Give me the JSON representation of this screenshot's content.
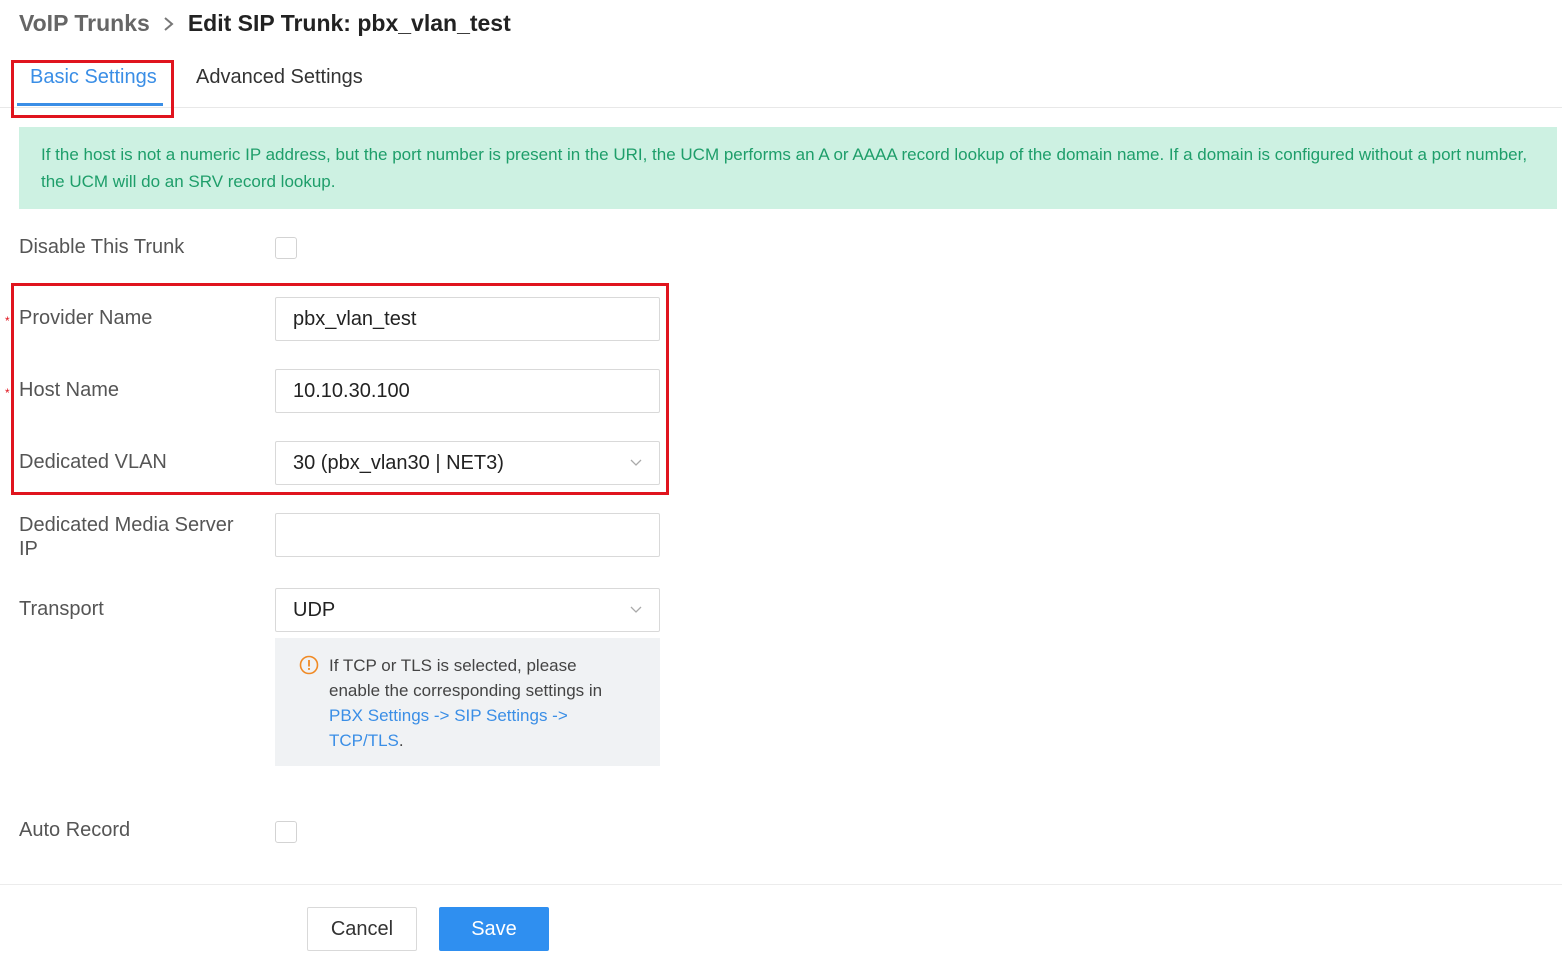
{
  "breadcrumb": {
    "parent": "VoIP Trunks",
    "separator_icon": "chevron-right-icon",
    "current": "Edit SIP Trunk: pbx_vlan_test"
  },
  "tabs": [
    {
      "label": "Basic Settings",
      "active": true
    },
    {
      "label": "Advanced Settings",
      "active": false
    }
  ],
  "notice": {
    "text": "If the host is not a numeric IP address, but the port number is present in the URI, the UCM performs an A or AAAA record lookup of the domain name. If a domain is configured without a port number, the UCM will do an SRV record lookup."
  },
  "form": {
    "disable_trunk": {
      "label": "Disable This Trunk",
      "checked": false
    },
    "provider_name": {
      "label": "Provider Name",
      "value": "pbx_vlan_test",
      "required": true
    },
    "host_name": {
      "label": "Host Name",
      "value": "10.10.30.100",
      "required": true
    },
    "dedicated_vlan": {
      "label": "Dedicated VLAN",
      "value": "30 (pbx_vlan30 | NET3)"
    },
    "media_server_ip": {
      "label": "Dedicated Media Server IP",
      "value": ""
    },
    "transport": {
      "label": "Transport",
      "value": "UDP"
    },
    "auto_record": {
      "label": "Auto Record",
      "checked": false
    }
  },
  "transport_warning": {
    "icon": "exclamation-circle-icon",
    "text_before": "If TCP or TLS is selected, please enable the corresponding settings in ",
    "link_text": "PBX Settings -> SIP Settings -> TCP/TLS",
    "text_after": "."
  },
  "buttons": {
    "cancel": "Cancel",
    "save": "Save"
  },
  "colors": {
    "accent": "#3a8ee6",
    "save_button": "#2f8ff0",
    "highlight": "#e0141e",
    "notice_bg": "#cdf1e2",
    "notice_text": "#1e9e6a",
    "warning_icon": "#f08a24"
  }
}
